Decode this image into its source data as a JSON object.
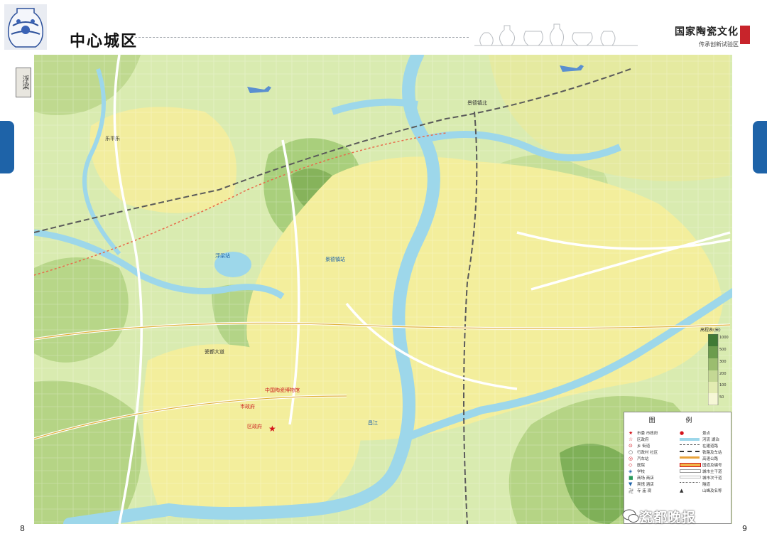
{
  "header": {
    "title": "中心城区",
    "brand_title": "国家陶瓷文化",
    "brand_sub": "传承创新试验区",
    "side_label": "浮梁"
  },
  "pages": {
    "left": "8",
    "right": "9"
  },
  "watermark": "瓷都晚报",
  "colors": {
    "water": "#9dd7ea",
    "urban": "#f6f09e",
    "green": "#cfe3a2",
    "hill": "#8fb96a",
    "rail": "#5a5a5a",
    "road": "#ffffff",
    "tab": "#1e63a8",
    "seal": "#c8242b"
  },
  "map": {
    "places": [
      {
        "label": "乐平乐",
        "type": "district"
      },
      {
        "label": "瓷都大道",
        "type": "road"
      },
      {
        "label": "市政府",
        "type": "govt"
      },
      {
        "label": "浮梁站",
        "type": "station"
      },
      {
        "label": "昌江",
        "type": "river"
      },
      {
        "label": "景德镇北",
        "type": "station"
      },
      {
        "label": "区政府",
        "type": "govt"
      },
      {
        "label": "中国陶瓷博物馆",
        "type": "poi"
      },
      {
        "label": "景德镇站",
        "type": "station"
      }
    ]
  },
  "legend": {
    "title": "图 例",
    "left_items": [
      "市委 市政府",
      "区政府",
      "乡 街道",
      "行政村 社区",
      "汽车站",
      "医院",
      "学校",
      "商场 商店",
      "宾馆 酒店",
      "寺 庙 观",
      "",
      "",
      ""
    ],
    "right_items": [
      "景点",
      "河流 湖泊",
      "在建道路",
      "铁路及车站",
      "高速公路",
      "国道及编号",
      "城市主干道",
      "城市次干道",
      "隧道",
      "山峰及名称"
    ]
  },
  "elevation": {
    "title": "高程表(米)",
    "levels": [
      "1000",
      "500",
      "300",
      "200",
      "100",
      "50"
    ]
  }
}
